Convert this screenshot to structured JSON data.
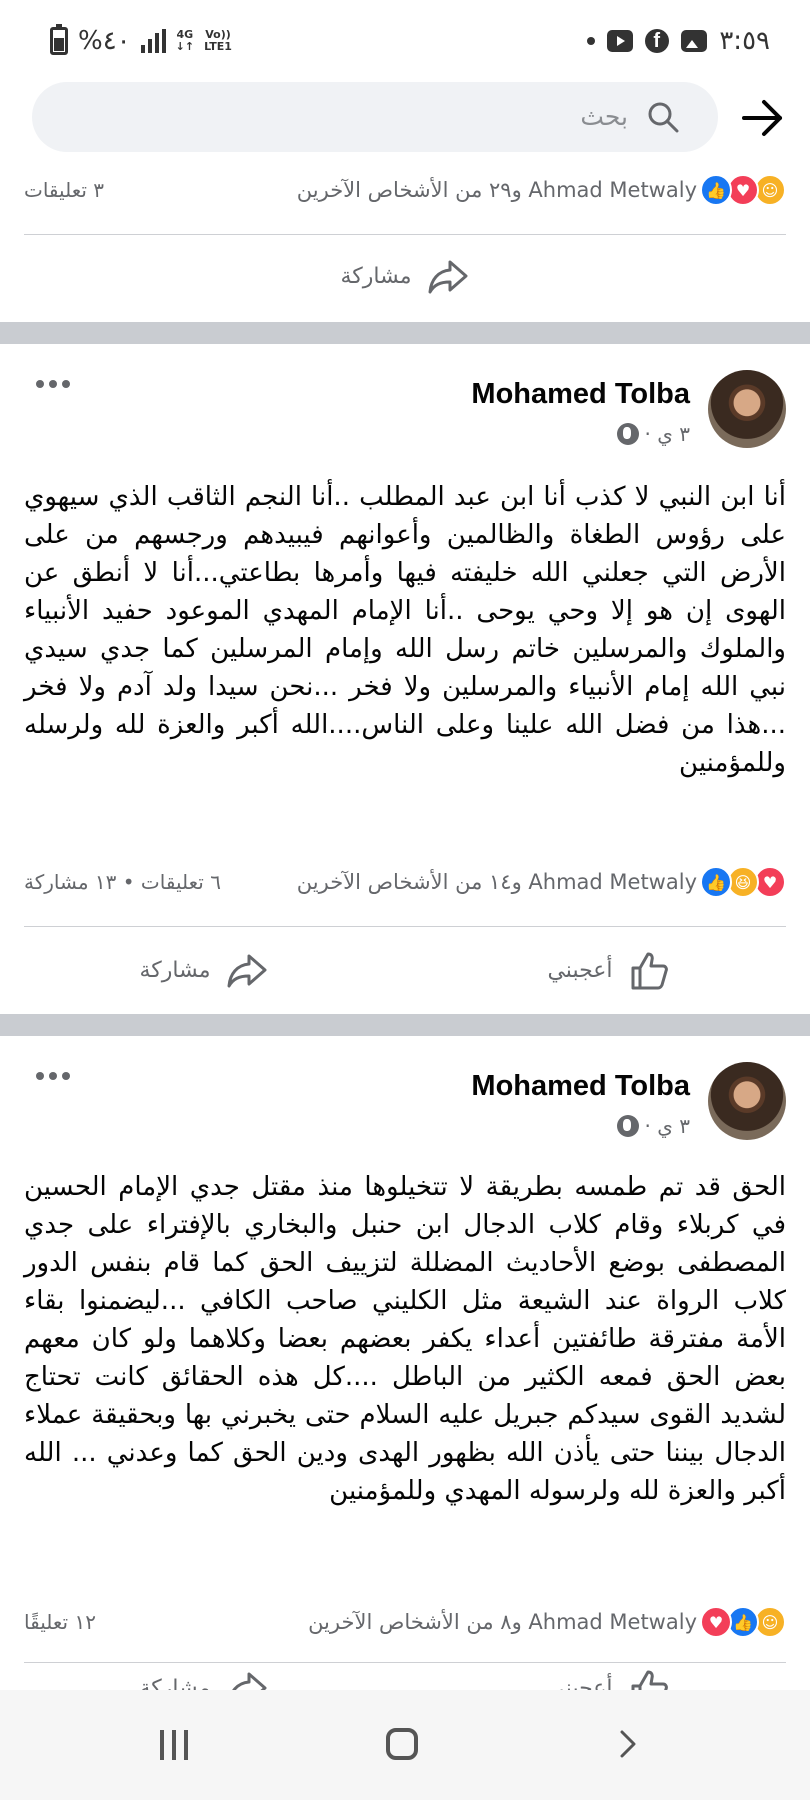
{
  "status_bar": {
    "battery": "%٤٠",
    "network_top": "4G",
    "network_bottom": "",
    "lte_top": "Vo))",
    "lte_bottom": "LTE1",
    "time": "٣:٥٩"
  },
  "search": {
    "placeholder": "بحث"
  },
  "prev_post": {
    "reactions_text": "Ahmad Metwaly و٢٩ من الأشخاص الآخرين",
    "comments": "٣ تعليقات",
    "share_label": "مشاركة"
  },
  "post1": {
    "author": "Mohamed Tolba",
    "time": "٣ ي ·",
    "text": "أنا ابن النبي لا كذب أنا ابن عبد المطلب ..أنا النجم الثاقب الذي سيهوي على رؤوس الطغاة والظالمين وأعوانهم فيبيدهم ورجسهم من على الأرض التي جعلني الله خليفته فيها وأمرها بطاعتي...أنا لا أنطق عن الهوى إن هو إلا وحي يوحى ..أنا الإمام المهدي الموعود حفيد الأنبياء والملوك والمرسلين خاتم رسل الله وإمام المرسلين كما جدي سيدي نبي الله إمام الأنبياء والمرسلين ولا فخر ...نحن سيدا ولد آدم ولا فخر ...هذا من فضل الله علينا وعلى الناس....الله أكبر والعزة لله ولرسله وللمؤمنين",
    "reactions_text": "Ahmad Metwaly و١٤ من الأشخاص الآخرين",
    "stats": "٦ تعليقات • ١٣ مشاركة",
    "like_label": "أعجبني",
    "share_label": "مشاركة"
  },
  "post2": {
    "author": "Mohamed Tolba",
    "time": "٣ ي ·",
    "text": "الحق قد تم طمسه بطريقة لا تتخيلوها منذ مقتل جدي الإمام الحسين في كربلاء وقام كلاب الدجال ابن حنبل والبخاري بالإفتراء على جدي المصطفى بوضع الأحاديث المضللة لتزييف الحق كما قام بنفس الدور كلاب الرواة عند الشيعة مثل الكليني صاحب الكافي ...ليضمنوا بقاء الأمة مفترقة طائفتين أعداء يكفر بعضهم بعضا وكلاهما ولو كان معهم بعض الحق فمعه الكثير من الباطل ....كل هذه الحقائق كانت تحتاج لشديد القوى سيدكم جبريل عليه السلام حتى يخبرني بها وبحقيقة عملاء الدجال بيننا حتى يأذن الله بظهور الهدى ودين الحق كما وعدني ... الله أكبر والعزة لله ولرسوله المهدي وللمؤمنين",
    "reactions_text": "Ahmad Metwaly و٨ من الأشخاص الآخرين",
    "comments": "١٢ تعليقًا",
    "like_label": "أعجبني",
    "share_label": "مشاركة"
  },
  "icons": {
    "search": "search-icon",
    "back": "arrow-back-icon",
    "like": "thumbs-up-icon",
    "share": "share-arrow-icon",
    "more": "more-dots-icon",
    "globe": "globe-icon"
  },
  "colors": {
    "like_blue": "#1877f2",
    "love_red": "#f33e58",
    "care_yellow": "#f7b125",
    "secondary_text": "#65676b",
    "separator": "#c9ccd1"
  }
}
